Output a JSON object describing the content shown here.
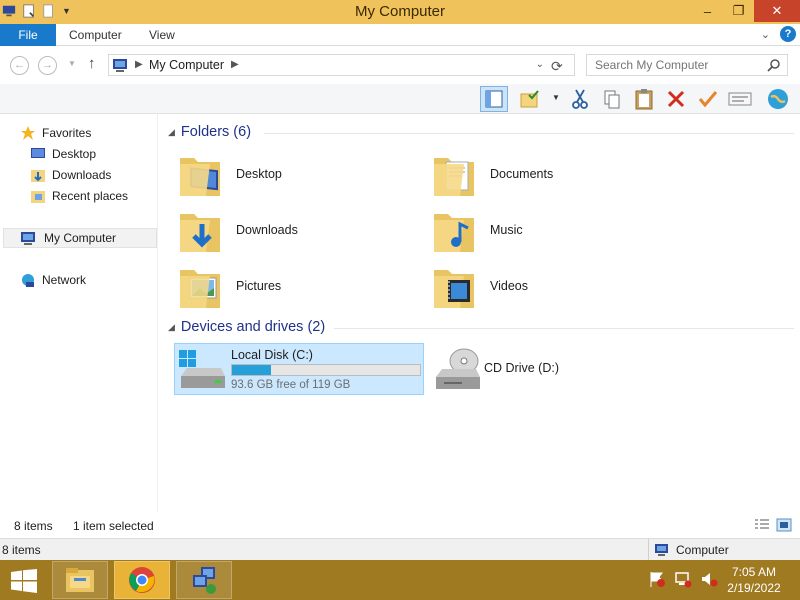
{
  "window": {
    "title": "My Computer"
  },
  "ribbon": {
    "tabs": [
      "File",
      "Computer",
      "View"
    ]
  },
  "address": {
    "crumb": "My Computer"
  },
  "search": {
    "placeholder": "Search My Computer"
  },
  "nav": {
    "favorites": "Favorites",
    "desktop": "Desktop",
    "downloads": "Downloads",
    "recent": "Recent places",
    "computer": "My Computer",
    "network": "Network"
  },
  "sections": {
    "folders": "Folders (6)",
    "devices": "Devices and drives (2)"
  },
  "folders": [
    "Desktop",
    "Documents",
    "Downloads",
    "Music",
    "Pictures",
    "Videos"
  ],
  "drives": {
    "c": {
      "label": "Local Disk (C:)",
      "free": "93.6 GB free of 119 GB",
      "used_fraction": 0.21
    },
    "d": {
      "label": "CD Drive (D:)"
    }
  },
  "status": {
    "items": "8 items",
    "selected": "1 item selected"
  },
  "status2": {
    "items": "8 items",
    "zone": "Computer"
  },
  "clock": {
    "time": "7:05 AM",
    "date": "2/19/2022"
  },
  "colors": {
    "titlebar": "#f0c25c",
    "file_tab": "#1979ca",
    "taskbar": "#a07a20",
    "selection": "#cce8ff",
    "progress": "#26a0da",
    "section_text": "#1e3287"
  }
}
